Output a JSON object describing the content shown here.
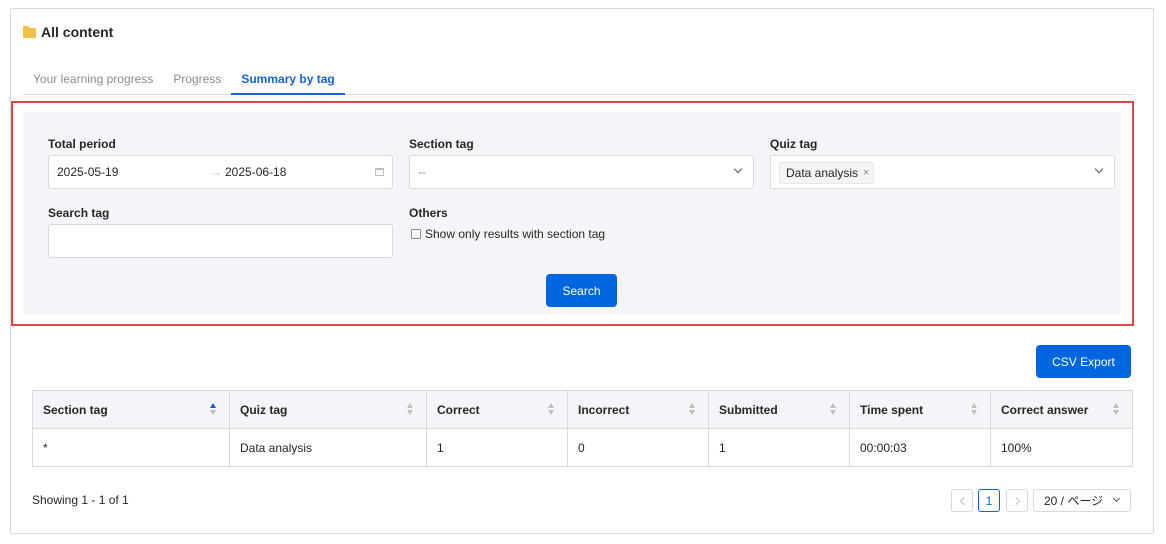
{
  "page": {
    "title": "All content"
  },
  "tabs": [
    "Your learning progress",
    "Progress",
    "Summary by tag"
  ],
  "filters": {
    "period_label": "Total period",
    "date_start": "2025-05-19",
    "date_arrow": "→",
    "date_end": "2025-06-18",
    "section_tag_label": "Section tag",
    "section_tag_value": "--",
    "quiz_tag_label": "Quiz tag",
    "quiz_tag_chip": "Data analysis",
    "quiz_tag_chip_remove": "×",
    "search_tag_label": "Search tag",
    "search_tag_value": "",
    "others_label": "Others",
    "checkbox_label": "Show only results with section tag",
    "search_button": "Search"
  },
  "export_button": "CSV Export",
  "table": {
    "headers": [
      "Section tag",
      "Quiz tag",
      "Correct",
      "Incorrect",
      "Submitted",
      "Time spent",
      "Correct answer"
    ],
    "rows": [
      [
        "*",
        "Data analysis",
        "1",
        "0",
        "1",
        "00:00:03",
        "100%"
      ]
    ]
  },
  "pagination": {
    "showing": "Showing 1 - 1 of 1",
    "current_page": "1",
    "page_size": "20 / ページ"
  },
  "colors": {
    "accent": "#1463d8",
    "button": "#0066e0",
    "highlight": "#e54545",
    "folder": "#f5c04a"
  }
}
